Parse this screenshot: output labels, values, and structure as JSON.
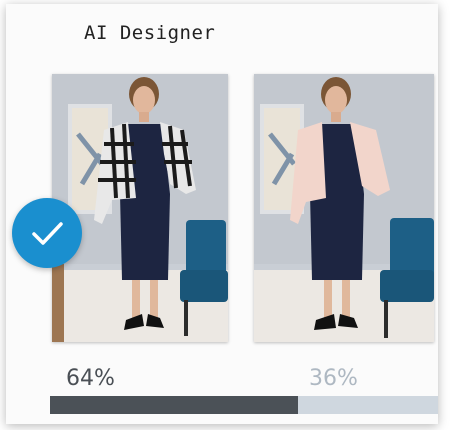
{
  "app": {
    "title": "AI Designer"
  },
  "options": [
    {
      "outfit": "black-white-plaid-cropped-jacket",
      "percent_label": "64%",
      "share": 0.64,
      "selected": true
    },
    {
      "outfit": "blush-pink-cropped-jacket",
      "percent_label": "36%",
      "share": 0.36,
      "selected": false
    }
  ],
  "icons": {
    "selected": "checkmark-icon"
  },
  "colors": {
    "accent": "#1a8fcf",
    "bar_fill": "#4b5157",
    "bar_track": "#cfd7df",
    "winner_text": "#4a4f55",
    "loser_text": "#aeb8c2"
  }
}
